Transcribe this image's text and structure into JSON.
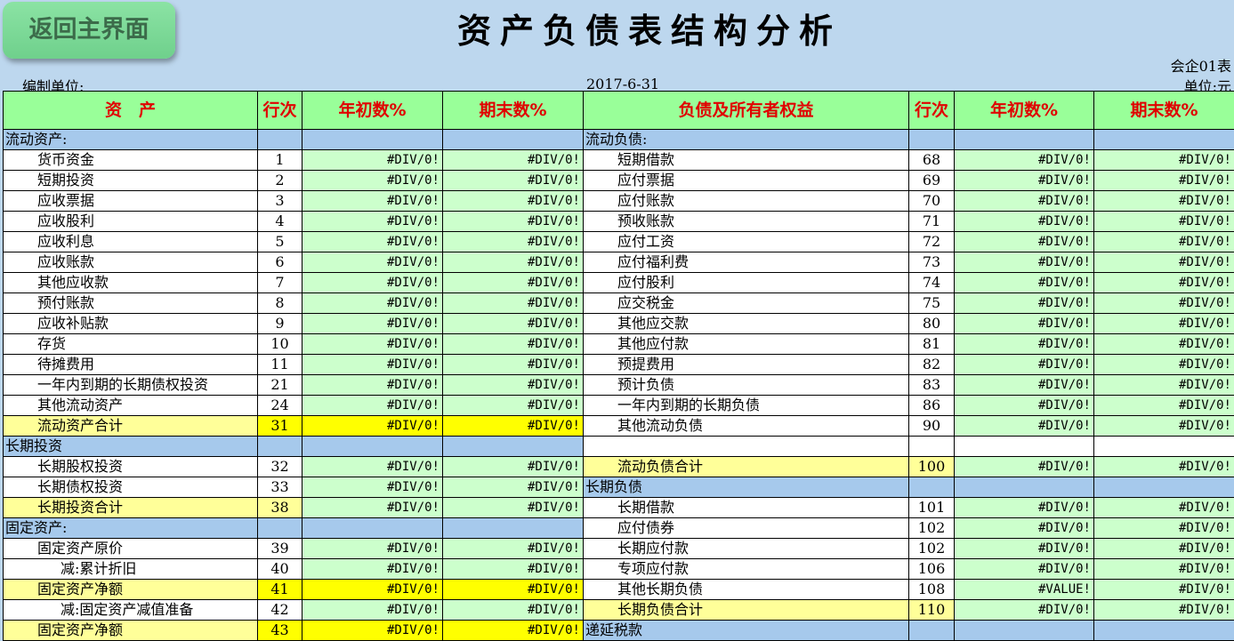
{
  "back_button": "返回主界面",
  "title": "资产负债表结构分析",
  "form_code": "会企01表",
  "org_label": "编制单位:",
  "date": "2017-6-31",
  "unit_label": "单位:元",
  "headers": [
    "资　产",
    "行次",
    "年初数%",
    "期末数%",
    "负债及所有者权益",
    "行次",
    "年初数%",
    "期末数%"
  ],
  "colors": {
    "header": "#99ff99",
    "header_text": "#e00000",
    "section": "#a6c9ec",
    "value": "#ccffcc",
    "total": "#ffff99",
    "highlight": "#ffff00",
    "background": "#bdd7ee"
  },
  "rows": [
    {
      "l": {
        "name": "流动资产:",
        "kind": "sec"
      },
      "r": {
        "name": "流动负债:",
        "kind": "sec"
      }
    },
    {
      "l": {
        "name": "货币资金",
        "line": "1",
        "y0": "#DIV/0!",
        "y1": "#DIV/0!"
      },
      "r": {
        "name": "短期借款",
        "line": "68",
        "y0": "#DIV/0!",
        "y1": "#DIV/0!"
      }
    },
    {
      "l": {
        "name": "短期投资",
        "line": "2",
        "y0": "#DIV/0!",
        "y1": "#DIV/0!"
      },
      "r": {
        "name": "应付票据",
        "line": "69",
        "y0": "#DIV/0!",
        "y1": "#DIV/0!"
      }
    },
    {
      "l": {
        "name": "应收票据",
        "line": "3",
        "y0": "#DIV/0!",
        "y1": "#DIV/0!"
      },
      "r": {
        "name": "应付账款",
        "line": "70",
        "y0": "#DIV/0!",
        "y1": "#DIV/0!"
      }
    },
    {
      "l": {
        "name": "应收股利",
        "line": "4",
        "y0": "#DIV/0!",
        "y1": "#DIV/0!"
      },
      "r": {
        "name": "预收账款",
        "line": "71",
        "y0": "#DIV/0!",
        "y1": "#DIV/0!"
      }
    },
    {
      "l": {
        "name": "应收利息",
        "line": "5",
        "y0": "#DIV/0!",
        "y1": "#DIV/0!"
      },
      "r": {
        "name": "应付工资",
        "line": "72",
        "y0": "#DIV/0!",
        "y1": "#DIV/0!"
      }
    },
    {
      "l": {
        "name": "应收账款",
        "line": "6",
        "y0": "#DIV/0!",
        "y1": "#DIV/0!"
      },
      "r": {
        "name": "应付福利费",
        "line": "73",
        "y0": "#DIV/0!",
        "y1": "#DIV/0!"
      }
    },
    {
      "l": {
        "name": "其他应收款",
        "line": "7",
        "y0": "#DIV/0!",
        "y1": "#DIV/0!"
      },
      "r": {
        "name": "应付股利",
        "line": "74",
        "y0": "#DIV/0!",
        "y1": "#DIV/0!"
      }
    },
    {
      "l": {
        "name": "预付账款",
        "line": "8",
        "y0": "#DIV/0!",
        "y1": "#DIV/0!"
      },
      "r": {
        "name": "应交税金",
        "line": "75",
        "y0": "#DIV/0!",
        "y1": "#DIV/0!"
      }
    },
    {
      "l": {
        "name": "应收补贴款",
        "line": "9",
        "y0": "#DIV/0!",
        "y1": "#DIV/0!"
      },
      "r": {
        "name": "其他应交款",
        "line": "80",
        "y0": "#DIV/0!",
        "y1": "#DIV/0!"
      }
    },
    {
      "l": {
        "name": "存货",
        "line": "10",
        "y0": "#DIV/0!",
        "y1": "#DIV/0!"
      },
      "r": {
        "name": "其他应付款",
        "line": "81",
        "y0": "#DIV/0!",
        "y1": "#DIV/0!"
      }
    },
    {
      "l": {
        "name": "待摊费用",
        "line": "11",
        "y0": "#DIV/0!",
        "y1": "#DIV/0!"
      },
      "r": {
        "name": "预提费用",
        "line": "82",
        "y0": "#DIV/0!",
        "y1": "#DIV/0!"
      }
    },
    {
      "l": {
        "name": "一年内到期的长期债权投资",
        "line": "21",
        "y0": "#DIV/0!",
        "y1": "#DIV/0!"
      },
      "r": {
        "name": "预计负债",
        "line": "83",
        "y0": "#DIV/0!",
        "y1": "#DIV/0!"
      }
    },
    {
      "l": {
        "name": "其他流动资产",
        "line": "24",
        "y0": "#DIV/0!",
        "y1": "#DIV/0!"
      },
      "r": {
        "name": "一年内到期的长期负债",
        "line": "86",
        "y0": "#DIV/0!",
        "y1": "#DIV/0!"
      }
    },
    {
      "l": {
        "name": "流动资产合计",
        "line": "31",
        "y0": "#DIV/0!",
        "y1": "#DIV/0!",
        "kind": "bright"
      },
      "r": {
        "name": "其他流动负债",
        "line": "90",
        "y0": "#DIV/0!",
        "y1": "#DIV/0!"
      }
    },
    {
      "l": {
        "name": "长期投资",
        "kind": "sec"
      },
      "r": {
        "name": "",
        "kind": "empty"
      }
    },
    {
      "l": {
        "name": "长期股权投资",
        "line": "32",
        "y0": "#DIV/0!",
        "y1": "#DIV/0!"
      },
      "r": {
        "name": "流动负债合计",
        "line": "100",
        "y0": "#DIV/0!",
        "y1": "#DIV/0!",
        "kind": "total"
      }
    },
    {
      "l": {
        "name": "长期债权投资",
        "line": "33",
        "y0": "#DIV/0!",
        "y1": "#DIV/0!"
      },
      "r": {
        "name": "长期负债",
        "kind": "sec"
      }
    },
    {
      "l": {
        "name": "长期投资合计",
        "line": "38",
        "y0": "#DIV/0!",
        "y1": "#DIV/0!",
        "kind": "total"
      },
      "r": {
        "name": "长期借款",
        "line": "101",
        "y0": "#DIV/0!",
        "y1": "#DIV/0!"
      }
    },
    {
      "l": {
        "name": "固定资产:",
        "kind": "sec"
      },
      "r": {
        "name": "应付债券",
        "line": "102",
        "y0": "#DIV/0!",
        "y1": "#DIV/0!"
      }
    },
    {
      "l": {
        "name": "固定资产原价",
        "line": "39",
        "y0": "#DIV/0!",
        "y1": "#DIV/0!"
      },
      "r": {
        "name": "长期应付款",
        "line": "102",
        "y0": "#DIV/0!",
        "y1": "#DIV/0!"
      }
    },
    {
      "l": {
        "name": "减:累计折旧",
        "line": "40",
        "y0": "#DIV/0!",
        "y1": "#DIV/0!",
        "indent": 2
      },
      "r": {
        "name": "专项应付款",
        "line": "106",
        "y0": "#DIV/0!",
        "y1": "#DIV/0!"
      }
    },
    {
      "l": {
        "name": "固定资产净额",
        "line": "41",
        "y0": "#DIV/0!",
        "y1": "#DIV/0!",
        "kind": "bright"
      },
      "r": {
        "name": "其他长期负债",
        "line": "108",
        "y0": "#VALUE!",
        "y1": "#DIV/0!"
      }
    },
    {
      "l": {
        "name": "减:固定资产减值准备",
        "line": "42",
        "y0": "#DIV/0!",
        "y1": "#DIV/0!",
        "indent": 2
      },
      "r": {
        "name": "长期负债合计",
        "line": "110",
        "y0": "#DIV/0!",
        "y1": "#DIV/0!",
        "kind": "total"
      }
    },
    {
      "l": {
        "name": "固定资产净额",
        "line": "43",
        "y0": "#DIV/0!",
        "y1": "#DIV/0!",
        "kind": "bright"
      },
      "r": {
        "name": "递延税款",
        "kind": "sec"
      }
    }
  ]
}
